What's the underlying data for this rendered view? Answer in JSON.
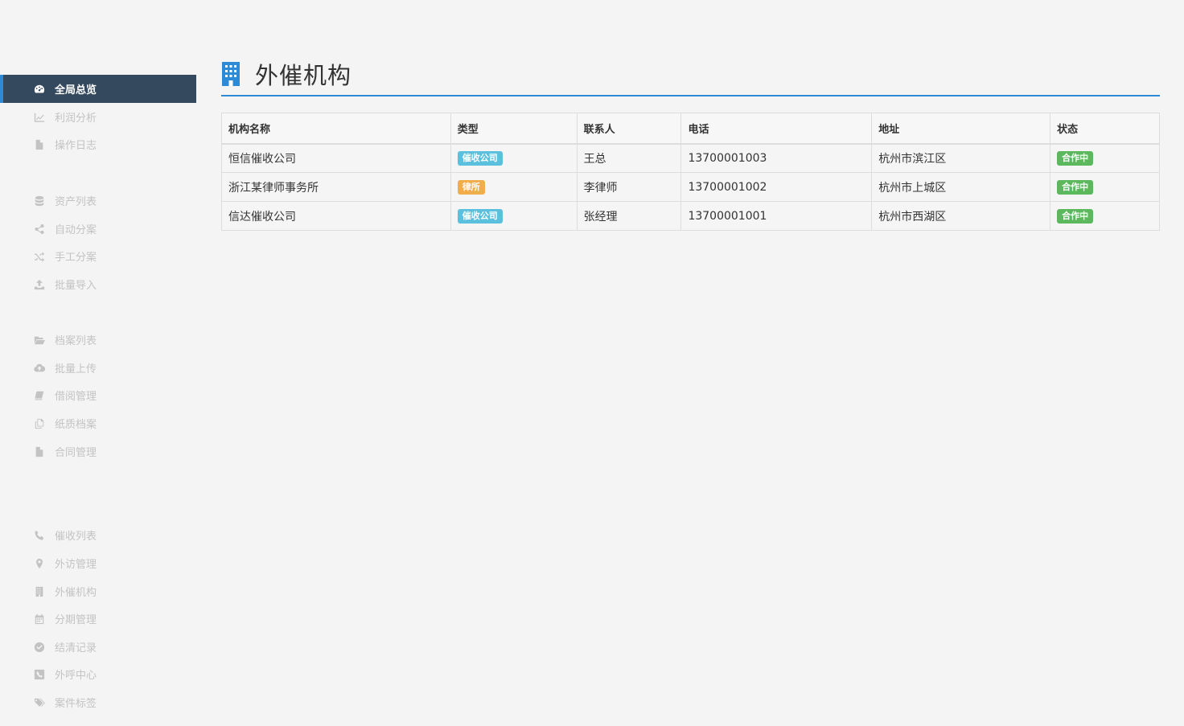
{
  "page": {
    "title": "外催机构"
  },
  "sidebar": {
    "items": [
      {
        "label": "全局总览",
        "icon": "dashboard-icon",
        "active": true
      },
      {
        "label": "利润分析",
        "icon": "line-chart-icon"
      },
      {
        "label": "操作日志",
        "icon": "file-icon"
      },
      {
        "label": "资产列表",
        "icon": "database-icon"
      },
      {
        "label": "自动分案",
        "icon": "share-icon"
      },
      {
        "label": "手工分案",
        "icon": "shuffle-icon"
      },
      {
        "label": "批量导入",
        "icon": "upload-icon"
      },
      {
        "label": "档案列表",
        "icon": "folder-open-icon"
      },
      {
        "label": "批量上传",
        "icon": "cloud-upload-icon"
      },
      {
        "label": "借阅管理",
        "icon": "book-icon"
      },
      {
        "label": "纸质档案",
        "icon": "copy-icon"
      },
      {
        "label": "合同管理",
        "icon": "file-icon"
      },
      {
        "label": "催收列表",
        "icon": "phone-icon"
      },
      {
        "label": "外访管理",
        "icon": "map-marker-icon"
      },
      {
        "label": "外催机构",
        "icon": "building-icon"
      },
      {
        "label": "分期管理",
        "icon": "calendar-icon"
      },
      {
        "label": "结清记录",
        "icon": "check-circle-icon"
      },
      {
        "label": "外呼中心",
        "icon": "phone-square-icon"
      },
      {
        "label": "案件标签",
        "icon": "tags-icon"
      }
    ]
  },
  "table": {
    "headers": [
      "机构名称",
      "类型",
      "联系人",
      "电话",
      "地址",
      "状态"
    ],
    "rows": [
      {
        "name": "恒信催收公司",
        "type": "催收公司",
        "type_color": "#5bc0de",
        "contact": "王总",
        "phone": "13700001003",
        "address": "杭州市滨江区",
        "status": "合作中"
      },
      {
        "name": "浙江某律师事务所",
        "type": "律所",
        "type_color": "#f0ad4e",
        "contact": "李律师",
        "phone": "13700001002",
        "address": "杭州市上城区",
        "status": "合作中"
      },
      {
        "name": "信达催收公司",
        "type": "催收公司",
        "type_color": "#5bc0de",
        "contact": "张经理",
        "phone": "13700001001",
        "address": "杭州市西湖区",
        "status": "合作中"
      }
    ]
  },
  "colors": {
    "accent": "#2d8ad6",
    "sidebar_active": "#34495e",
    "status_ok": "#5cb85c"
  }
}
